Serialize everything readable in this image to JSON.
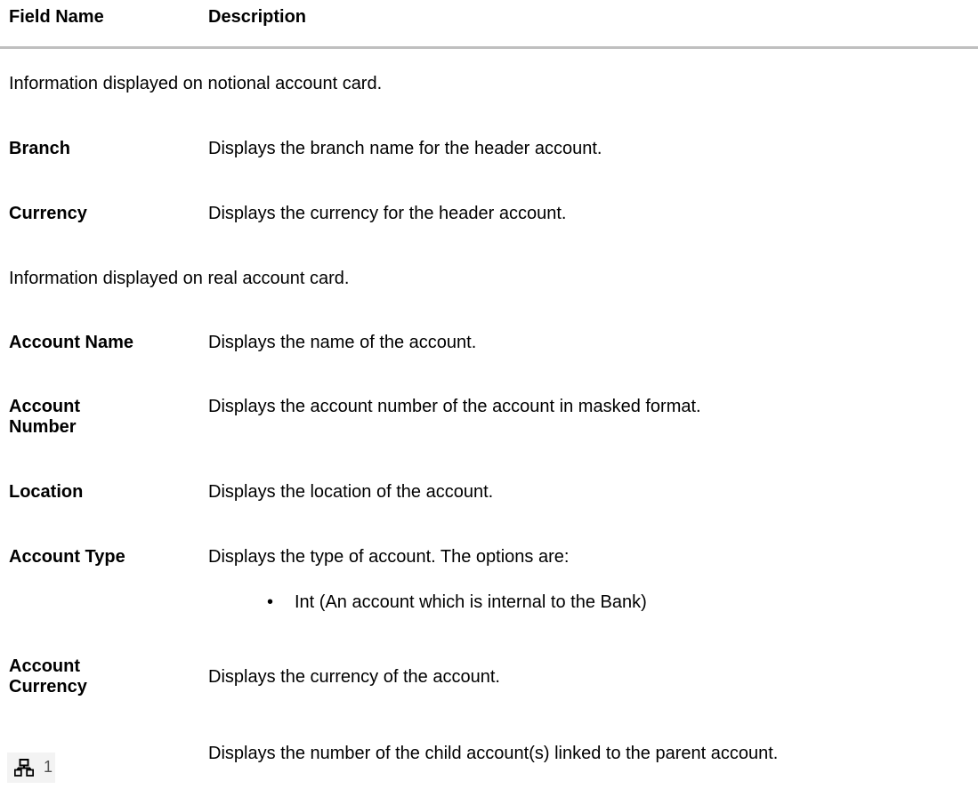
{
  "header": {
    "field_name": "Field Name",
    "description": "Description"
  },
  "sections": {
    "notional_intro": "Information displayed on notional account card.",
    "real_intro": "Information displayed on real account card."
  },
  "fields": {
    "branch": {
      "name": "Branch",
      "desc": "Displays the branch name for the header account."
    },
    "currency": {
      "name": "Currency",
      "desc": "Displays the currency for the header account."
    },
    "account_name": {
      "name": "Account Name",
      "desc": "Displays the name of the account."
    },
    "account_number": {
      "name_line1": "Account",
      "name_line2": "Number",
      "desc": "Displays the account number of the account in masked format."
    },
    "location": {
      "name": "Location",
      "desc": "Displays the location of the account."
    },
    "account_type": {
      "name": "Account Type",
      "desc": "Displays the type of account. The options are:",
      "bullet": "•",
      "option": "Int (An account which is internal to the Bank)"
    },
    "account_currency": {
      "name_line1": "Account",
      "name_line2": "Currency",
      "desc": "Displays the currency of the account."
    },
    "child_accounts": {
      "icon": "hierarchy-icon",
      "count": "1",
      "desc": "Displays the number of the child account(s) linked to the parent account."
    }
  }
}
